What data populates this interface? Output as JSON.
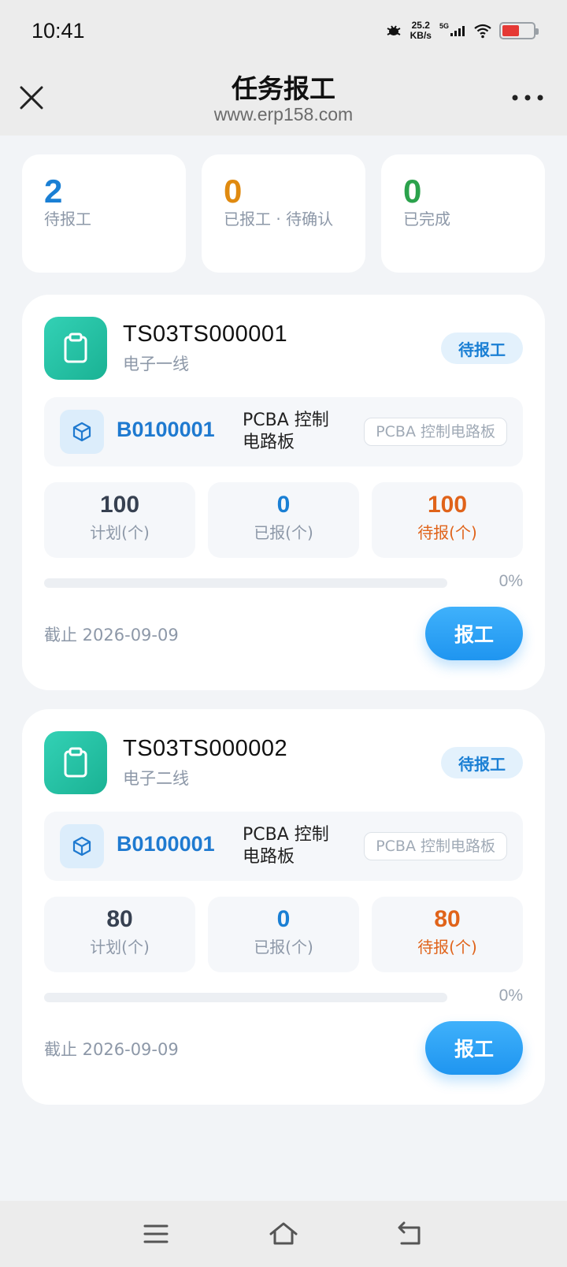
{
  "status_bar": {
    "time": "10:41",
    "speed_value": "25.2",
    "speed_unit": "KB/s",
    "network": "5G",
    "battery_fill_fraction": 0.55,
    "icons": [
      "bug-icon",
      "signal-icon",
      "wifi-icon",
      "battery-icon"
    ]
  },
  "header": {
    "title": "任务报工",
    "url": "www.erp158.com",
    "close_icon": "close-icon",
    "more_icon": "more-icon"
  },
  "summary": [
    {
      "value": "2",
      "label": "待报工",
      "color": "#1a7fd4"
    },
    {
      "value": "0",
      "label": "已报工 · 待确认",
      "color": "#e08a10"
    },
    {
      "value": "0",
      "label": "已完成",
      "color": "#2ba24c"
    }
  ],
  "tasks": [
    {
      "task_no": "TS03TS000001",
      "line": "电子一线",
      "status": "待报工",
      "product_code": "B0100001",
      "product_name": "PCBA 控制电路板",
      "product_spec": "PCBA 控制电路板",
      "plan_qty": "100",
      "plan_label": "计划(个)",
      "reported_qty": "0",
      "reported_label": "已报(个)",
      "pending_qty": "100",
      "pending_label": "待报(个)",
      "progress": "0%",
      "progress_fraction": 0,
      "deadline": "截止 2026-09-09",
      "button_label": "报工"
    },
    {
      "task_no": "TS03TS000002",
      "line": "电子二线",
      "status": "待报工",
      "product_code": "B0100001",
      "product_name": "PCBA 控制电路板",
      "product_spec": "PCBA 控制电路板",
      "plan_qty": "80",
      "plan_label": "计划(个)",
      "reported_qty": "0",
      "reported_label": "已报(个)",
      "pending_qty": "80",
      "pending_label": "待报(个)",
      "progress": "0%",
      "progress_fraction": 0,
      "deadline": "截止 2026-09-09",
      "button_label": "报工"
    }
  ],
  "colors": {
    "plan": "#374151",
    "reported": "#1a7fd4",
    "pending": "#e0631a",
    "label_gray": "#8d98a8",
    "accent": "#2b9cf2"
  },
  "bottom_nav": {
    "icons": [
      "menu-icon",
      "home-icon",
      "back-icon"
    ]
  }
}
